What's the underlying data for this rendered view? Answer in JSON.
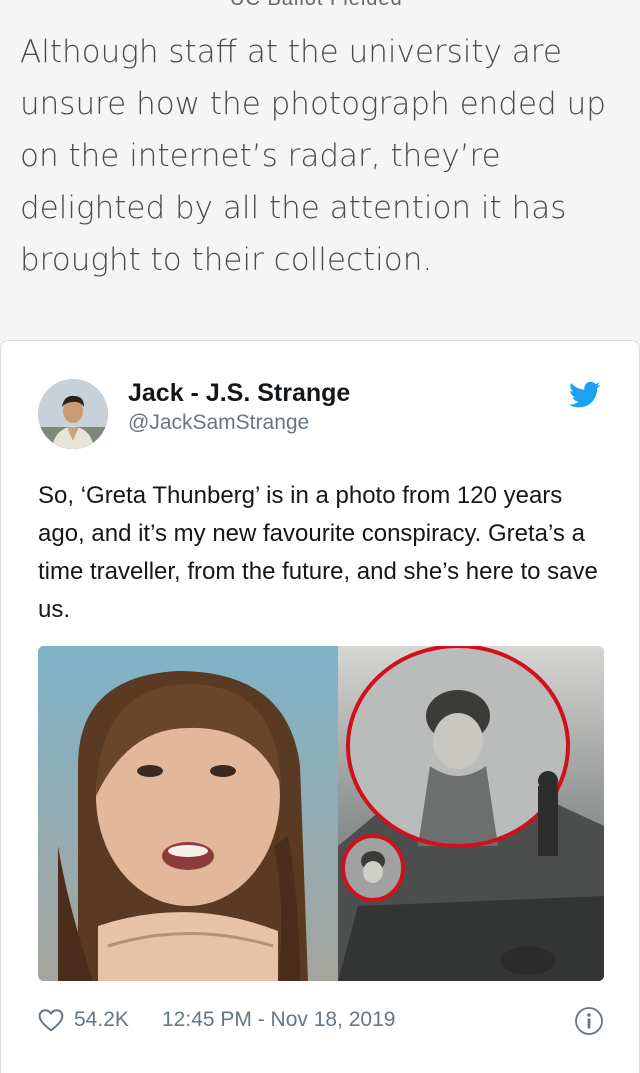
{
  "article": {
    "cutoff_text": "UC Ballot Fielded",
    "paragraph": "Although staff at the university are unsure how the photograph ended up on the internet’s radar, they’re delighted by all the attention it has brought to their collection."
  },
  "tweet": {
    "display_name": "Jack - J.S. Strange",
    "handle": "@JackSamStrange",
    "text": "So, ‘Greta Thunberg’ is in a photo from 120 years ago, and it’s my new favourite conspiracy. Greta’s a time traveller, from the future, and she’s here to save us.",
    "like_count": "54.2K",
    "timestamp": "12:45 PM - Nov 18, 2019",
    "icons": {
      "brand": "twitter-bird-icon",
      "like": "heart-icon",
      "info": "info-icon"
    },
    "colors": {
      "brand_blue": "#1da1f2",
      "text_primary": "#14171a",
      "text_secondary": "#657786",
      "highlight_circle": "#d0101c"
    }
  }
}
